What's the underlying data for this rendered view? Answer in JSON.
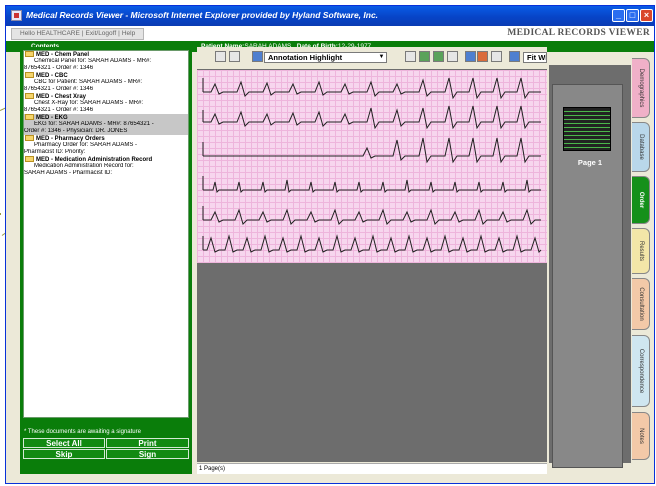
{
  "window": {
    "title": "Medical Records Viewer - Microsoft Internet Explorer provided by Hyland Software, Inc."
  },
  "topbar": {
    "links": [
      "Hello HEALTHCARE",
      "Exit/Logoff",
      "Help"
    ],
    "brand": "MEDICAL RECORDS VIEWER"
  },
  "header": {
    "contents_label": "Contents",
    "patient_name_label": "Patient Name:",
    "patient_name": "SARAH ADAMS",
    "dob_label": "Date of Birth:",
    "dob": "12-29-1977"
  },
  "documents": [
    {
      "folder": "MED - Chem Panel",
      "lines": [
        "Chemical Panel for: SARAH ADAMS - MR#:",
        "87654321 - Order #: 1346"
      ],
      "selected": false
    },
    {
      "folder": "MED - CBC",
      "lines": [
        "CBC for Patient: SARAH ADAMS - MR#:",
        "87654321 - Order #: 1346"
      ],
      "selected": false
    },
    {
      "folder": "MED - Chest Xray",
      "lines": [
        "Chest X-Ray for: SARAH ADAMS - MR#:",
        "87654321 - Order #: 1346"
      ],
      "selected": false
    },
    {
      "folder": "MED - EKG",
      "lines": [
        "EKG for: SARAH ADAMS - MR#: 87654321 -",
        "Order #: 1346 - Physician: DR. JONES"
      ],
      "selected": true
    },
    {
      "folder": "MED - Pharmacy Orders",
      "lines": [
        "Pharmacy Order for: SARAH ADAMS -",
        "Pharmacist ID: Priority:"
      ],
      "selected": false
    },
    {
      "folder": "MED - Medication Administration Record",
      "lines": [
        "Medication Administration Record for:",
        "SARAH ADAMS - Pharmacist ID:"
      ],
      "selected": false
    }
  ],
  "left_footer": {
    "note": "* These documents are awaiting a signature",
    "buttons": [
      "Select All",
      "Print",
      "Skip",
      "Sign"
    ]
  },
  "toolbar": {
    "annotation_select": "Annotation Highlight",
    "zoom_select": "Fit Width"
  },
  "thumbnail": {
    "page_label": "Page 1"
  },
  "status": {
    "page_count": "1 Page(s)"
  },
  "side_tabs": [
    "Demographics",
    "Database",
    "Order",
    "Results",
    "Consultation",
    "Correspondence",
    "Notes"
  ],
  "active_tab": "Order",
  "colors": {
    "accent_green": "#0a7d0a",
    "title_blue": "#0a5ce6",
    "ecg_grid": "#f7d6ee"
  }
}
